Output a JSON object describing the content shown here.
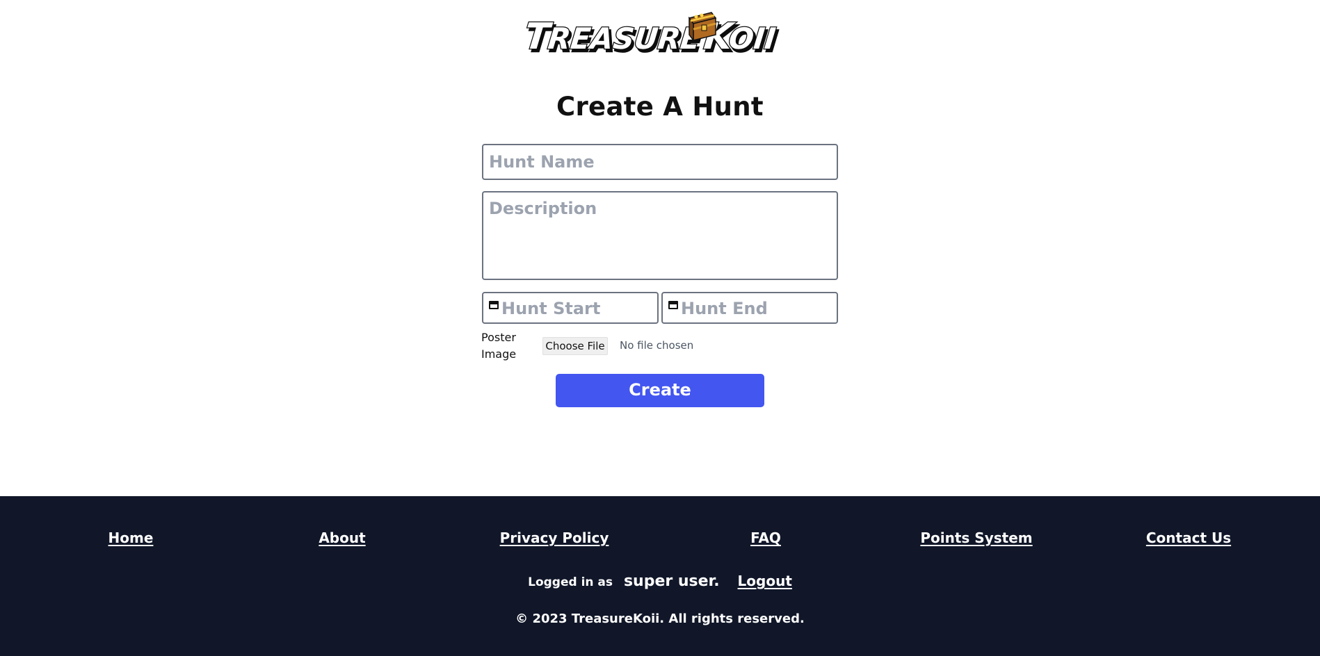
{
  "header": {
    "logo_text": "TreasureKoii"
  },
  "page": {
    "title": "Create A Hunt"
  },
  "form": {
    "hunt_name_placeholder": "Hunt Name",
    "description_placeholder": "Description",
    "hunt_start_placeholder": "Hunt Start",
    "hunt_end_placeholder": "Hunt End",
    "poster_label": "Poster Image",
    "choose_file_label": "Choose File",
    "file_status": "No file chosen",
    "create_label": "Create"
  },
  "footer": {
    "links": [
      "Home",
      "About",
      "Privacy Policy",
      "FAQ",
      "Points System",
      "Contact Us"
    ],
    "logged_in_prefix": "Logged in as",
    "username": "super user.",
    "logout_label": "Logout",
    "copyright": "© 2023 TreasureKoii. All rights reserved."
  },
  "colors": {
    "accent": "#4356f0",
    "footer_bg": "#111729",
    "placeholder": "#9ca3af",
    "chest_gold": "#d99a2b",
    "chest_wood": "#9a5b1e"
  },
  "icons": [
    "treasure-chest-icon",
    "calendar-icon"
  ]
}
